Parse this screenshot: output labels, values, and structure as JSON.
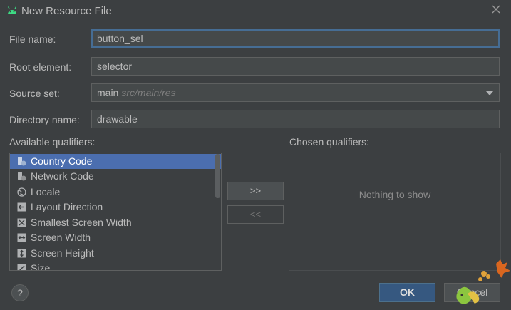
{
  "window": {
    "title": "New Resource File",
    "app_icon": "android-icon",
    "close_icon": "close-icon"
  },
  "form": {
    "file_name": {
      "label": "File name:",
      "value": "button_sel"
    },
    "root_element": {
      "label": "Root element:",
      "value": "selector"
    },
    "source_set": {
      "label": "Source set:",
      "value": "main",
      "hint": "src/main/res"
    },
    "directory_name": {
      "label": "Directory name:",
      "value": "drawable"
    }
  },
  "qualifiers": {
    "available_label": "Available qualifiers:",
    "chosen_label": "Chosen qualifiers:",
    "available": [
      {
        "label": "Country Code",
        "icon": "country-code-icon",
        "selected": true
      },
      {
        "label": "Network Code",
        "icon": "network-code-icon",
        "selected": false
      },
      {
        "label": "Locale",
        "icon": "globe-icon",
        "selected": false
      },
      {
        "label": "Layout Direction",
        "icon": "layout-direction-icon",
        "selected": false
      },
      {
        "label": "Smallest Screen Width",
        "icon": "smallest-screen-width-icon",
        "selected": false
      },
      {
        "label": "Screen Width",
        "icon": "screen-width-icon",
        "selected": false
      },
      {
        "label": "Screen Height",
        "icon": "screen-height-icon",
        "selected": false
      },
      {
        "label": "Size",
        "icon": "size-icon",
        "selected": false
      }
    ],
    "add_label": ">>",
    "remove_label": "<<",
    "empty_text": "Nothing to show"
  },
  "buttons": {
    "help": "?",
    "ok": "OK",
    "cancel": "Cancel"
  },
  "colors": {
    "background": "#3c3f41",
    "field_bg": "#45494a",
    "selection": "#4b6eaf",
    "focus_border": "#466d94",
    "ok_bg": "#365880"
  }
}
